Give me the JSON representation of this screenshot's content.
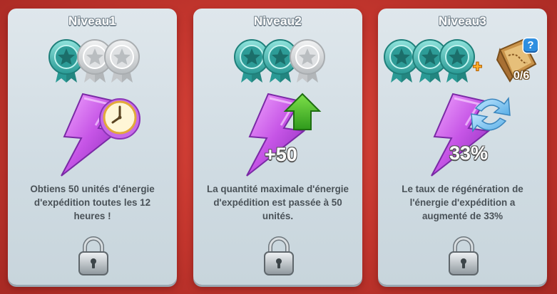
{
  "levels": [
    {
      "title": "Niveau1",
      "medals_earned": 1,
      "medals_total": 3,
      "description": "Obtiens 50 unités d'énergie d'expédition toutes les 12 heures !",
      "overlay_icon": "clock-icon",
      "locked": true
    },
    {
      "title": "Niveau2",
      "medals_earned": 2,
      "medals_total": 3,
      "stat": "+50",
      "description": "La quantité maximale d'énergie d'expédition est passée à 50 unités.",
      "overlay_icon": "up-arrow-icon",
      "locked": true
    },
    {
      "title": "Niveau3",
      "medals_earned": 3,
      "medals_total": 3,
      "stat": "33%",
      "extra_symbol": "+",
      "extra_badge": "?",
      "extra_progress": "0/6",
      "description": "Le taux de régénération de l'énergie d'expédition a augmenté de 33%",
      "overlay_icon": "refresh-arrows-icon",
      "locked": true
    }
  ],
  "colors": {
    "background": "#c2352d",
    "card": "#d6e0e6",
    "medal_active": "#3fb5b0",
    "medal_inactive": "#d7d9db",
    "energy": "#c656e6",
    "text": "#4a5258"
  }
}
